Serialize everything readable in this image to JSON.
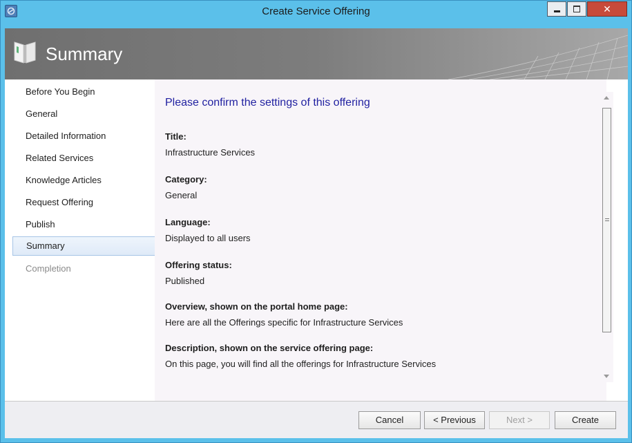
{
  "window": {
    "title": "Create Service Offering"
  },
  "banner": {
    "title": "Summary",
    "icon": "book-icon"
  },
  "nav": {
    "items": [
      {
        "label": "Before You Begin",
        "state": "normal"
      },
      {
        "label": "General",
        "state": "normal"
      },
      {
        "label": "Detailed Information",
        "state": "normal"
      },
      {
        "label": "Related Services",
        "state": "normal"
      },
      {
        "label": "Knowledge Articles",
        "state": "normal"
      },
      {
        "label": "Request Offering",
        "state": "normal"
      },
      {
        "label": "Publish",
        "state": "normal"
      },
      {
        "label": "Summary",
        "state": "selected"
      },
      {
        "label": "Completion",
        "state": "disabled"
      }
    ]
  },
  "main": {
    "heading": "Please confirm the settings of this offering",
    "fields": [
      {
        "label": "Title:",
        "value": "Infrastructure Services"
      },
      {
        "label": "Category:",
        "value": "General"
      },
      {
        "label": "Language:",
        "value": "Displayed to all users"
      },
      {
        "label": "Offering status:",
        "value": "Published"
      },
      {
        "label": "Overview, shown on the portal home page:",
        "value": "Here are all the Offerings specific for Infrastructure Services"
      },
      {
        "label": "Description, shown on the service offering page:",
        "value": "On this page, you will find all the offerings for Infrastructure Services"
      }
    ]
  },
  "footer": {
    "cancel_label": "Cancel",
    "previous_label": "< Previous",
    "next_label": "Next >",
    "create_label": "Create"
  },
  "colors": {
    "title_bar": "#5bc0ea",
    "heading": "#1f1fa0",
    "close_button": "#c74a3a"
  }
}
